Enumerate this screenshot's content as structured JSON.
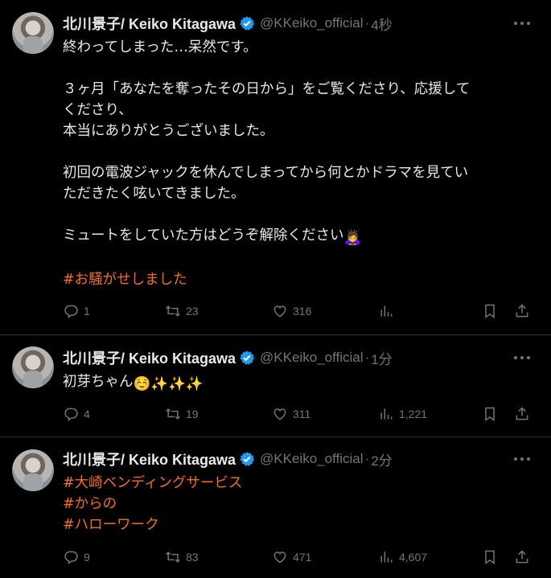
{
  "account": {
    "name": "北川景子/ Keiko Kitagawa",
    "handle": "@KKeiko_official"
  },
  "colors": {
    "background": "#000000",
    "text": "#e7e9ea",
    "muted": "#71767b",
    "hashtag": "#f26f21",
    "verified": "#1d9bf0",
    "divider": "#2f3336"
  },
  "tweets": [
    {
      "time": "4秒",
      "lines": [
        "終わってしまった…呆然です。",
        "",
        "３ヶ月「あなたを奪ったその日から」をご覧くださり、応援して",
        "くださり、",
        "本当にありがとうございました。",
        "",
        "初回の電波ジャックを休んでしまってから何とかドラマを見てい",
        "ただきたく呟いてきました。",
        "",
        "ミュートをしていた方はどうぞ解除ください"
      ],
      "emoji": "🙇‍♀️",
      "hashtags": [
        "#お騒がせしました"
      ],
      "replies": "1",
      "retweets": "23",
      "likes": "316",
      "views": ""
    },
    {
      "time": "1分",
      "text": "初芽ちゃん",
      "emoji": "☺️✨✨✨",
      "replies": "4",
      "retweets": "19",
      "likes": "311",
      "views": "1,221"
    },
    {
      "time": "2分",
      "hashtags": [
        "#大崎ベンディングサービス",
        "#からの",
        "#ハローワーク"
      ],
      "replies": "9",
      "retweets": "83",
      "likes": "471",
      "views": "4,607"
    }
  ],
  "icons": {
    "more": "more-dots-icon",
    "reply": "reply-icon",
    "retweet": "retweet-icon",
    "like": "heart-icon",
    "views": "analytics-icon",
    "bookmark": "bookmark-icon",
    "share": "share-icon",
    "verified": "verified-badge-icon"
  }
}
